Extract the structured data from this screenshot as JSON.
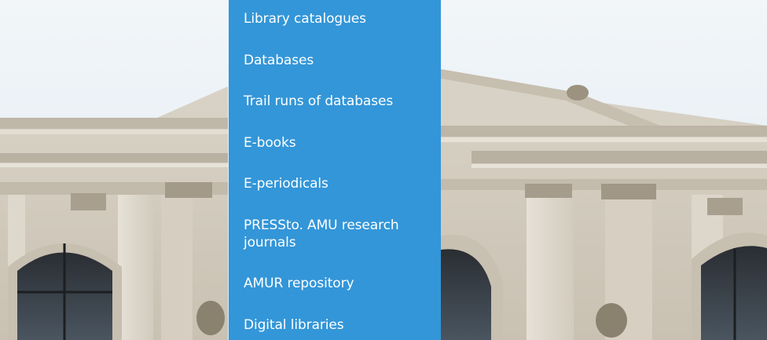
{
  "menu": {
    "accent": "#3396d8",
    "items": [
      {
        "label": "Library catalogues"
      },
      {
        "label": "Databases"
      },
      {
        "label": "Trail runs of databases"
      },
      {
        "label": "E-books"
      },
      {
        "label": "E-periodicals"
      },
      {
        "label": "PRESSto. AMU research journals"
      },
      {
        "label": "AMUR repository"
      },
      {
        "label": "Digital libraries"
      }
    ]
  },
  "hero_image": {
    "subject": "library-building-facade"
  }
}
